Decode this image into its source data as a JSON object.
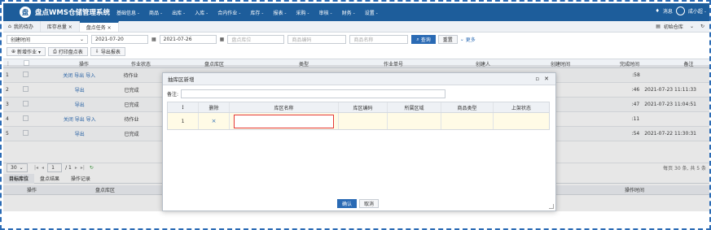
{
  "app": {
    "logo": "盘",
    "title": "盘点WMS仓储管理系统"
  },
  "menu": [
    "基础信息 -",
    "商品 -",
    "出库 -",
    "入库 -",
    "合内作业 -",
    "库存 -",
    "报表 -",
    "采购 -",
    "审核 -",
    "财务 -",
    "设置 -"
  ],
  "top_right": {
    "notice": "消息",
    "user": "成小超 -"
  },
  "tabs": [
    {
      "label": "我的待办"
    },
    {
      "label": "库存总量  ×"
    },
    {
      "label": "盘点任务  ×"
    }
  ],
  "tab_right": {
    "warehouse": "初始仓库",
    "arrow": "⌄",
    "refresh": "↻"
  },
  "filter": {
    "date_type": "创建时间",
    "date_from": "2021-07-20",
    "date_to": "2021-07-26",
    "zone_placeholder": "盘点库位",
    "product_placeholder": "商品编码",
    "name_placeholder": "商品名称",
    "search": "查询",
    "reset": "重置",
    "more": "更多"
  },
  "toolbar": {
    "new": "新增作业 ▾",
    "print": "打印盘点表",
    "export": "导出报表"
  },
  "grid": {
    "headers": [
      "",
      "",
      "操作",
      "作业状态",
      "盘点库区",
      "类型",
      "作业单号",
      "创建人",
      "创建时间",
      "完成时间",
      "备注"
    ],
    "rows": [
      {
        "no": "1",
        "ops": "关闭 导出 导入",
        "status": "待作业",
        "created": ":58",
        "done": ""
      },
      {
        "no": "2",
        "ops": "导出",
        "status": "已完成",
        "created": ":46",
        "done": "2021-07-23 11:11:33"
      },
      {
        "no": "3",
        "ops": "导出",
        "status": "已完成",
        "created": ":47",
        "done": "2021-07-23 11:04:51"
      },
      {
        "no": "4",
        "ops": "关闭 导出 导入",
        "status": "待作业",
        "created": ":11",
        "done": ""
      },
      {
        "no": "5",
        "ops": "导出",
        "status": "已完成",
        "created": ":54",
        "done": "2021-07-22 11:30:31"
      }
    ]
  },
  "pager": {
    "size": "30",
    "page": "1",
    "total_pages": "/ 1",
    "summary": "每页 30 条, 共 5 条"
  },
  "subtabs": [
    "目标库位",
    "盘点结果",
    "操作记录"
  ],
  "subhead": [
    "操作",
    "盘点库区",
    "操作时间"
  ],
  "modal": {
    "title": "抽库区新增",
    "remark_label": "备注:",
    "columns": [
      "⋮",
      "删除",
      "库区名称",
      "库区编码",
      "所属区域",
      "商品类型",
      "上架状态"
    ],
    "row": {
      "no": "1",
      "delete": "×"
    },
    "confirm": "确认",
    "cancel": "取消"
  }
}
